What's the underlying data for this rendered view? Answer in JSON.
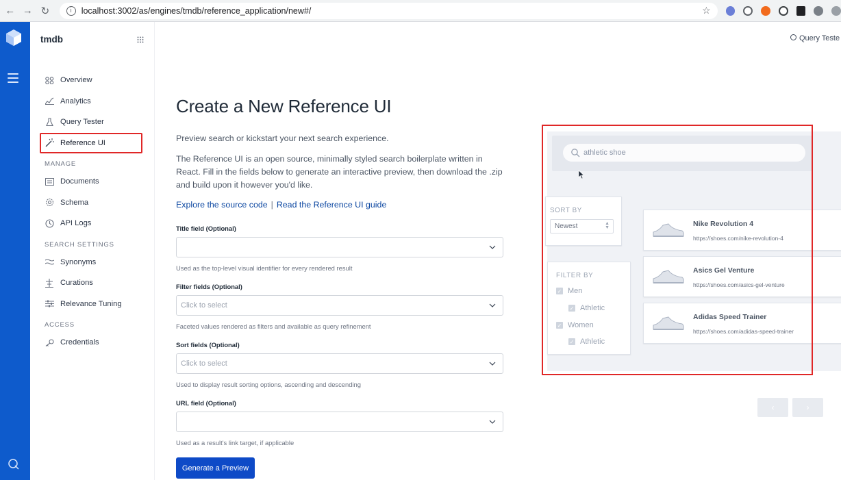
{
  "browser": {
    "url": "localhost:3002/as/engines/tmdb/reference_application/new#/",
    "back": "←",
    "forward": "→",
    "reload": "↻",
    "info_icon": "i",
    "star_icon": "☆"
  },
  "sidebar": {
    "engine_name": "tmdb",
    "items_top": [
      {
        "label": "Overview",
        "icon": "overview-icon"
      },
      {
        "label": "Analytics",
        "icon": "analytics-icon"
      },
      {
        "label": "Query Tester",
        "icon": "flask-icon"
      },
      {
        "label": "Reference UI",
        "icon": "wand-icon",
        "active": true
      }
    ],
    "manage_label": "MANAGE",
    "items_manage": [
      {
        "label": "Documents",
        "icon": "documents-icon"
      },
      {
        "label": "Schema",
        "icon": "gear-icon"
      },
      {
        "label": "API Logs",
        "icon": "clock-icon"
      }
    ],
    "search_settings_label": "SEARCH SETTINGS",
    "items_search": [
      {
        "label": "Synonyms",
        "icon": "synonyms-icon"
      },
      {
        "label": "Curations",
        "icon": "curations-icon"
      },
      {
        "label": "Relevance Tuning",
        "icon": "sliders-icon"
      }
    ],
    "access_label": "ACCESS",
    "items_access": [
      {
        "label": "Credentials",
        "icon": "key-icon"
      }
    ]
  },
  "main": {
    "title": "Create a New Reference UI",
    "lede": "Preview search or kickstart your next search experience.",
    "description": "The Reference UI is an open source, minimally styled search boilerplate written in React. Fill in the fields below to generate an interactive preview, then download the .zip and build upon it however you'd like.",
    "link_source": "Explore the source code",
    "link_separator": "|",
    "link_guide": "Read the Reference UI guide",
    "fields": {
      "title": {
        "label": "Title field (Optional)",
        "value": "",
        "hint": "Used as the top-level visual identifier for every rendered result"
      },
      "filter": {
        "label": "Filter fields (Optional)",
        "placeholder": "Click to select",
        "hint": "Faceted values rendered as filters and available as query refinement"
      },
      "sort": {
        "label": "Sort fields (Optional)",
        "placeholder": "Click to select",
        "hint": "Used to display result sorting options, ascending and descending"
      },
      "url": {
        "label": "URL field (Optional)",
        "value": "",
        "hint": "Used as a result's link target, if applicable"
      }
    },
    "generate_button": "Generate a Preview"
  },
  "preview": {
    "search_placeholder": "athletic shoe",
    "sort_label": "SORT BY",
    "sort_value": "Newest",
    "filter_label": "FILTER BY",
    "filters": [
      {
        "label": "Men",
        "checked": true,
        "indent": false
      },
      {
        "label": "Athletic",
        "checked": true,
        "indent": true
      },
      {
        "label": "Women",
        "checked": true,
        "indent": false
      },
      {
        "label": "Athletic",
        "checked": true,
        "indent": true
      }
    ],
    "results": [
      {
        "title": "Nike Revolution 4",
        "url": "https://shoes.com/nike-revolution-4"
      },
      {
        "title": "Asics Gel Venture",
        "url": "https://shoes.com/asics-gel-venture"
      },
      {
        "title": "Adidas Speed Trainer",
        "url": "https://shoes.com/adidas-speed-trainer"
      }
    ],
    "pager_prev": "‹",
    "pager_next": "›"
  },
  "top_right": {
    "query_tester_link": "Query Teste"
  },
  "colors": {
    "rail": "#0e5bcc",
    "primary_button": "#0e4ac7",
    "highlight_box": "#e02727",
    "link": "#0c47a1"
  }
}
